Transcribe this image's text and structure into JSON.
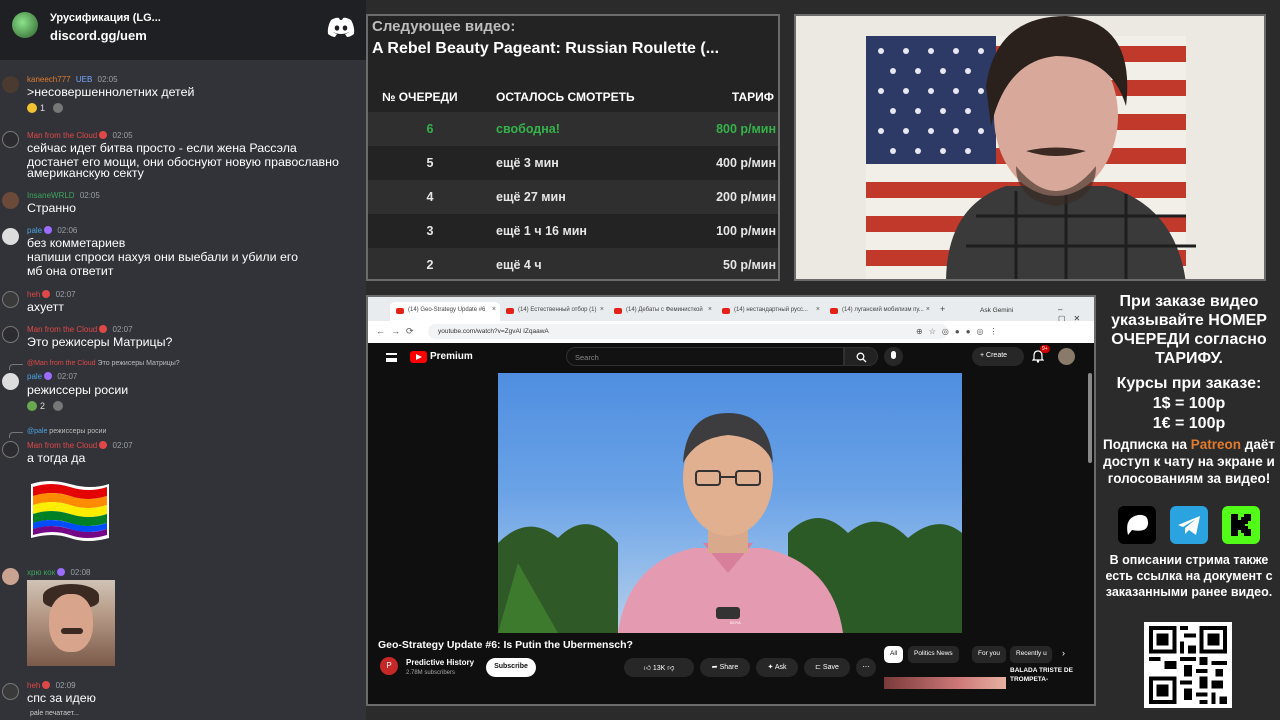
{
  "chat": {
    "server_name": "Урусификация (LG...",
    "server_invite": "discord.gg/uem",
    "messages": [
      {
        "user": "kaneech777",
        "user_color": "#e07b2e",
        "badge": "UEB",
        "time": "02:05",
        "lines": [
          ">несовершеннолетних детей"
        ],
        "reaction_count": "1"
      },
      {
        "user": "Man from the Cloud",
        "user_color": "#e04848",
        "time": "02:05",
        "lines": [
          "сейчас идет битва просто - если жена Рассэла",
          "достанет его мощи, они обоснуют новую православно",
          "американскую секту"
        ]
      },
      {
        "user": "InsaneWRLD",
        "user_color": "#3ba55c",
        "time": "02:05",
        "lines": [
          "Странно"
        ]
      },
      {
        "user": "pale",
        "user_color": "#4aa3df",
        "time": "02:06",
        "lines": [
          "без комметариев",
          "напиши спроси нахуя они выебали и убили его",
          "мб она ответит"
        ]
      },
      {
        "user": "heh",
        "user_color": "#e04848",
        "time": "02:07",
        "lines": [
          "ахуетт"
        ]
      },
      {
        "user": "Man from the Cloud",
        "user_color": "#e04848",
        "time": "02:07",
        "lines": [
          "Это режисеры Матрицы?"
        ]
      },
      {
        "reply_to": "@Man from the Cloud",
        "reply_text": "Это режисеры Матрицы?",
        "user": "pale",
        "user_color": "#4aa3df",
        "time": "02:07",
        "lines": [
          "режиссеры росии"
        ],
        "reaction_count": "2"
      },
      {
        "reply_to": "@pale",
        "reply_text": "режиссеры росии",
        "user": "Man from the Cloud",
        "user_color": "#e04848",
        "time": "02:07",
        "lines": [
          "а тогда да"
        ]
      },
      {
        "user": "хрю кок",
        "user_color": "#3ba55c",
        "time": "02:08",
        "lines": []
      },
      {
        "user": "heh",
        "user_color": "#e04848",
        "time": "02:09",
        "lines": [
          "спс за идею"
        ]
      }
    ],
    "typing": "pale печатает..."
  },
  "queue": {
    "next_label": "Следующее видео:",
    "next_title": "A Rebel Beauty Pageant: Russian Roulette (...",
    "headers": {
      "num": "№ ОЧЕРЕДИ",
      "left": "ОСТАЛОСЬ СМОТРЕТЬ",
      "tariff": "ТАРИФ"
    },
    "rows": [
      {
        "num": "6",
        "left": "свободна!",
        "tariff": "800 р/мин"
      },
      {
        "num": "5",
        "left": "ещё 3 мин",
        "tariff": "400 р/мин"
      },
      {
        "num": "4",
        "left": "ещё 27 мин",
        "tariff": "200 р/мин"
      },
      {
        "num": "3",
        "left": "ещё 1 ч 16 мин",
        "tariff": "100 р/мин"
      },
      {
        "num": "2",
        "left": "ещё 4 ч",
        "tariff": "50 р/мин"
      }
    ]
  },
  "browser": {
    "tabs": [
      {
        "label": "(14) Geo-Strategy Update #6"
      },
      {
        "label": "(14) Естественный отбор (1)"
      },
      {
        "label": "(14) Дебаты с Феминисткой"
      },
      {
        "label": "(14) нестандартный русс..."
      },
      {
        "label": "(14) луганский мобилизм пу..."
      }
    ],
    "ask_gemini": "Ask Gemini",
    "url": "youtube.com/watch?v=ZgvAl IZqaawA"
  },
  "youtube": {
    "brand": "Premium",
    "search_placeholder": "Search",
    "create_label": "Create",
    "bell_count": "9+",
    "video_title": "Geo-Strategy Update #6: Is Putin the Ubermensch?",
    "channel_initial": "P",
    "channel_name": "Predictive History",
    "channel_subs": "2.78M subscribers",
    "subscribe_label": "Subscribe",
    "likes": "13K",
    "share_label": "Share",
    "ask_label": "Ask",
    "save_label": "Save",
    "chips": [
      "All",
      "Politics News",
      "For you",
      "Recently u"
    ],
    "rec_title": "BALADA TRISTE DE TROMPETA-",
    "mic_badge": "BOYA"
  },
  "info": {
    "order_text": "При заказе видео указывайте НОМЕР ОЧЕРЕДИ согласно ТАРИФУ.",
    "rates_title": "Курсы при заказе:",
    "rate_usd": "1$ = 100р",
    "rate_eur": "1€ = 100р",
    "sub_prefix": "Подписка на",
    "sub_patreon": "Patreon",
    "sub_suffix": "даёт доступ к чату на экране и голосованиям за видео!",
    "desc": "В описании стрима также есть ссылка на документ с заказанными ранее видео."
  }
}
